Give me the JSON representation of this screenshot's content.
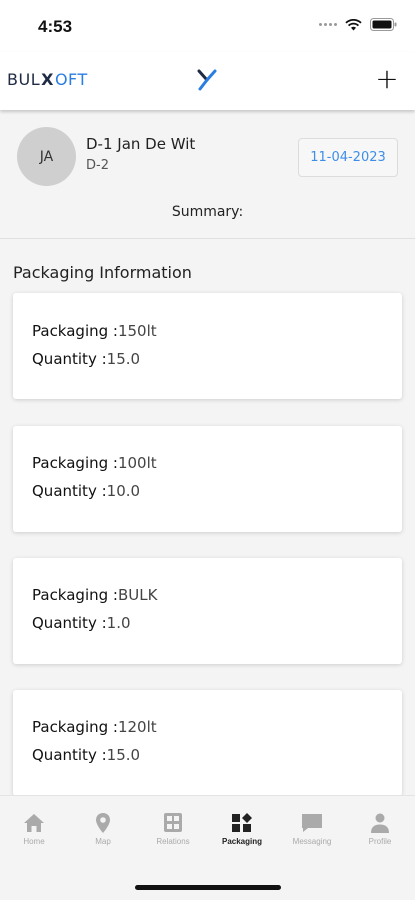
{
  "status": {
    "time": "4:53"
  },
  "header": {
    "logo_part1": "BUL",
    "logo_x": "X",
    "logo_part2": "OFT",
    "add_label": "+"
  },
  "driver": {
    "initials": "JA",
    "name": "D-1 Jan De Wit",
    "sub": "D-2",
    "date": "11-04-2023",
    "summary_label": "Summary:"
  },
  "section_title": "Packaging Information",
  "labels": {
    "packaging": "Packaging :",
    "quantity": "Quantity :"
  },
  "items": [
    {
      "packaging": "150lt",
      "quantity": "15.0"
    },
    {
      "packaging": "100lt",
      "quantity": "10.0"
    },
    {
      "packaging": "BULK",
      "quantity": "1.0"
    },
    {
      "packaging": "120lt",
      "quantity": "15.0"
    }
  ],
  "tabs": [
    {
      "label": "Home",
      "icon": "home-icon"
    },
    {
      "label": "Map",
      "icon": "map-pin-icon"
    },
    {
      "label": "Relations",
      "icon": "grid-icon"
    },
    {
      "label": "Packaging",
      "icon": "packaging-icon",
      "active": true
    },
    {
      "label": "Messaging",
      "icon": "message-icon"
    },
    {
      "label": "Profile",
      "icon": "profile-icon"
    }
  ],
  "colors": {
    "accent": "#3e8ee8",
    "brand_blue": "#2a7de1",
    "active_tab": "#222222",
    "inactive_tab": "#aaaaaa"
  }
}
